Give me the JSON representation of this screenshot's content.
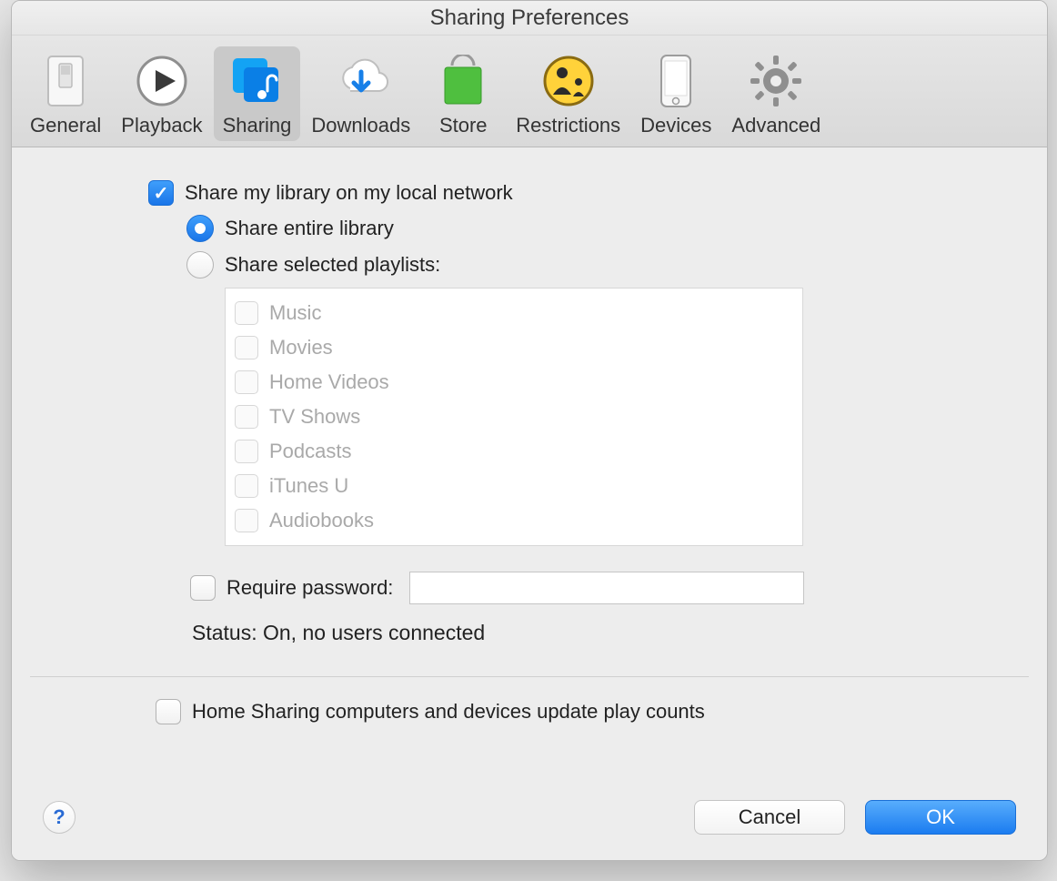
{
  "window": {
    "title": "Sharing Preferences"
  },
  "toolbar": {
    "items": [
      {
        "label": "General",
        "icon": "general"
      },
      {
        "label": "Playback",
        "icon": "playback"
      },
      {
        "label": "Sharing",
        "icon": "sharing",
        "selected": true
      },
      {
        "label": "Downloads",
        "icon": "downloads"
      },
      {
        "label": "Store",
        "icon": "store"
      },
      {
        "label": "Restrictions",
        "icon": "restrictions"
      },
      {
        "label": "Devices",
        "icon": "devices"
      },
      {
        "label": "Advanced",
        "icon": "advanced"
      }
    ]
  },
  "sharing": {
    "share_library_label": "Share my library on my local network",
    "share_library_checked": true,
    "mode": {
      "entire_label": "Share entire library",
      "entire_selected": true,
      "selected_label": "Share selected playlists:",
      "selected_selected": false
    },
    "playlists": {
      "enabled": false,
      "items": [
        {
          "label": "Music",
          "checked": false
        },
        {
          "label": "Movies",
          "checked": false
        },
        {
          "label": "Home Videos",
          "checked": false
        },
        {
          "label": "TV Shows",
          "checked": false
        },
        {
          "label": "Podcasts",
          "checked": false
        },
        {
          "label": "iTunes U",
          "checked": false
        },
        {
          "label": "Audiobooks",
          "checked": false
        }
      ]
    },
    "require_password_label": "Require password:",
    "require_password_checked": false,
    "password_value": "",
    "status_text": "Status: On, no users connected",
    "home_sharing_label": "Home Sharing computers and devices update play counts",
    "home_sharing_checked": false
  },
  "footer": {
    "help_glyph": "?",
    "cancel_label": "Cancel",
    "ok_label": "OK"
  },
  "colors": {
    "accent": "#1a7ae8"
  }
}
